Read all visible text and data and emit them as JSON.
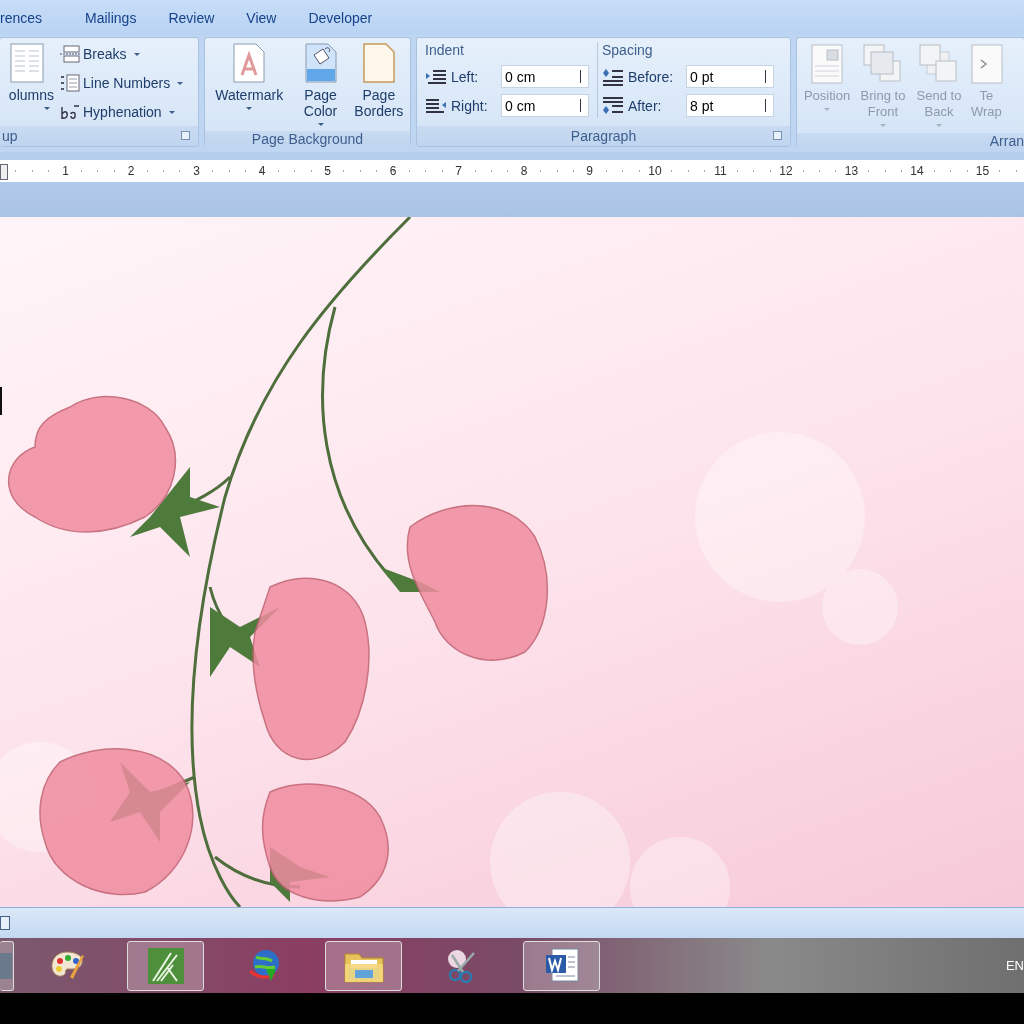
{
  "tabs": [
    {
      "label": "rences"
    },
    {
      "label": "Mailings"
    },
    {
      "label": "Review"
    },
    {
      "label": "View"
    },
    {
      "label": "Developer"
    }
  ],
  "ribbon": {
    "groups": [
      {
        "kind": "buttons",
        "label": "up",
        "launcher": true,
        "items": [
          {
            "kind": "big",
            "label": "olumns",
            "dropdown": true,
            "disabled": false
          },
          {
            "kind": "stack",
            "items": [
              {
                "label": "Breaks",
                "dropdown": true
              },
              {
                "label": "Line Numbers",
                "dropdown": true
              },
              {
                "label": "Hyphenation",
                "dropdown": true
              }
            ]
          }
        ]
      },
      {
        "kind": "buttons",
        "label": "Page Background",
        "launcher": false,
        "items": [
          {
            "kind": "big",
            "label": "Watermark",
            "dropdown": true,
            "disabled": false
          },
          {
            "kind": "big",
            "label": "Page Color",
            "dropdown": true,
            "disabled": false
          },
          {
            "kind": "big",
            "label": "Page Borders",
            "dropdown": false,
            "disabled": false
          }
        ]
      },
      {
        "kind": "paragraph",
        "label": "Paragraph",
        "launcher": true,
        "sections": [
          {
            "title": "Indent",
            "fields": [
              {
                "label": "Left:",
                "value": "0 cm"
              },
              {
                "label": "Right:",
                "value": "0 cm"
              }
            ]
          },
          {
            "title": "Spacing",
            "fields": [
              {
                "label": "Before:",
                "value": "0 pt"
              },
              {
                "label": "After:",
                "value": "8 pt"
              }
            ]
          }
        ]
      },
      {
        "kind": "buttons",
        "label": "Arran",
        "launcher": false,
        "items": [
          {
            "kind": "big",
            "label": "Position",
            "dropdown": true,
            "disabled": true
          },
          {
            "kind": "big",
            "label": "Bring to Front",
            "dropdown": true,
            "disabled": true
          },
          {
            "kind": "big",
            "label": "Send to Back",
            "dropdown": true,
            "disabled": true
          },
          {
            "kind": "big",
            "label": "Te Wrap",
            "dropdown": false,
            "disabled": true
          }
        ]
      }
    ]
  },
  "ruler": {
    "marks": [
      "1",
      "2",
      "3",
      "4",
      "5",
      "6",
      "7",
      "8",
      "9",
      "10",
      "11",
      "12",
      "13",
      "14",
      "15"
    ]
  },
  "page": {
    "text_cursor": true
  },
  "taskbar": {
    "items": [
      {
        "highlighted": true
      },
      {
        "highlighted": false
      },
      {
        "highlighted": true
      },
      {
        "highlighted": false
      },
      {
        "highlighted": true
      },
      {
        "highlighted": false
      },
      {
        "highlighted": true
      }
    ],
    "language": "EN"
  }
}
